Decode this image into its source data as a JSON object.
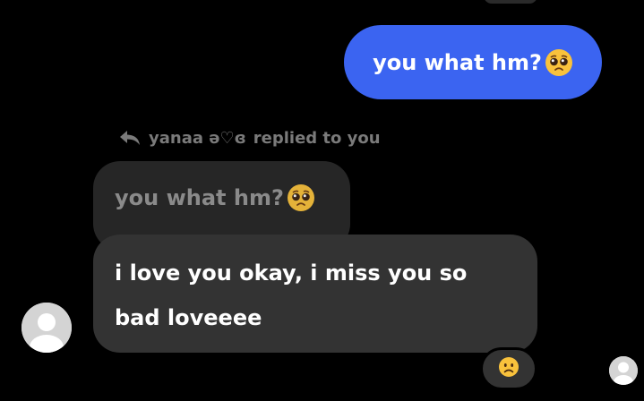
{
  "sent_message": {
    "text": "you what hm?",
    "emoji": "pleading-face-icon",
    "bubble_color": "#3b64f1"
  },
  "reply_header": {
    "name": "yanaa ə♡ɞ",
    "suffix": "replied to you"
  },
  "quoted_message": {
    "text": "you what hm?",
    "emoji": "pleading-face-icon"
  },
  "received_message": {
    "line1": "i love you okay, i miss you so",
    "line2": "bad loveeee"
  },
  "reaction": {
    "emoji": "frowning-face-icon"
  },
  "colors": {
    "background": "#000000",
    "received_bubble": "#333333",
    "quoted_bubble": "#262626",
    "emoji_yellow": "#f9c23c"
  }
}
